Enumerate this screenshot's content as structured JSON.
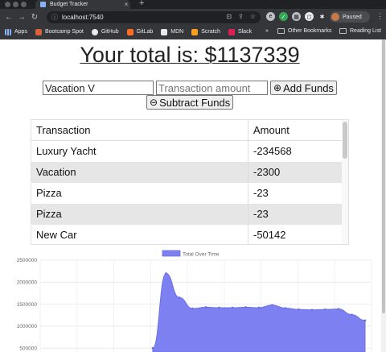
{
  "browser": {
    "tab_title": "Budget Tracker",
    "url": "localhost:7540",
    "profile_status": "Paused",
    "bookmarks": [
      {
        "label": "Apps",
        "icon": "apps-grid-icon",
        "color": "#8ab4f8"
      },
      {
        "label": "Bootcamp Spot",
        "icon": "bootcamp-icon",
        "color": "#d95f3b"
      },
      {
        "label": "GitHub",
        "icon": "github-icon",
        "color": "#e8eaed"
      },
      {
        "label": "GitLab",
        "icon": "gitlab-icon",
        "color": "#fc6d26"
      },
      {
        "label": "MDN",
        "icon": "mdn-icon",
        "color": "#e8eaed"
      },
      {
        "label": "Scratch",
        "icon": "scratch-icon",
        "color": "#f6a21e"
      },
      {
        "label": "Slack",
        "icon": "slack-icon",
        "color": "#e01e5a"
      }
    ],
    "overflow": "»",
    "other_bookmarks": "Other Bookmarks",
    "reading_list": "Reading List"
  },
  "app": {
    "total_text": "Your total is: $1137339",
    "name_input_value": "Vacation V",
    "amount_placeholder": "Transaction amount",
    "add_label": "Add Funds",
    "subtract_label": "Subtract Funds"
  },
  "table": {
    "headers": [
      "Transaction",
      "Amount"
    ],
    "rows": [
      {
        "name": "Luxury Yacht",
        "amount": "-234568"
      },
      {
        "name": "Vacation",
        "amount": "-2300"
      },
      {
        "name": "Pizza",
        "amount": "-23"
      },
      {
        "name": "Pizza",
        "amount": "-23"
      },
      {
        "name": "New Car",
        "amount": "-50142"
      },
      {
        "name": "",
        "amount": ""
      }
    ]
  },
  "chart_data": {
    "type": "area",
    "legend": [
      "Total Over Time"
    ],
    "legend_position": "top",
    "fill_color": "#7c80f0",
    "y_ticks": [
      "2500000",
      "2000000",
      "1500000",
      "1000000",
      "500000"
    ],
    "ylim": [
      500000,
      2500000
    ],
    "grid": true,
    "series": [
      {
        "name": "Total Over Time",
        "values": [
          500000,
          2200000,
          1650000,
          1400000,
          1430000,
          1420000,
          1420000,
          1430000,
          1420000,
          1480000,
          1410000,
          1380000,
          1370000,
          1380000,
          1390000,
          1260000,
          1130000
        ]
      }
    ]
  }
}
